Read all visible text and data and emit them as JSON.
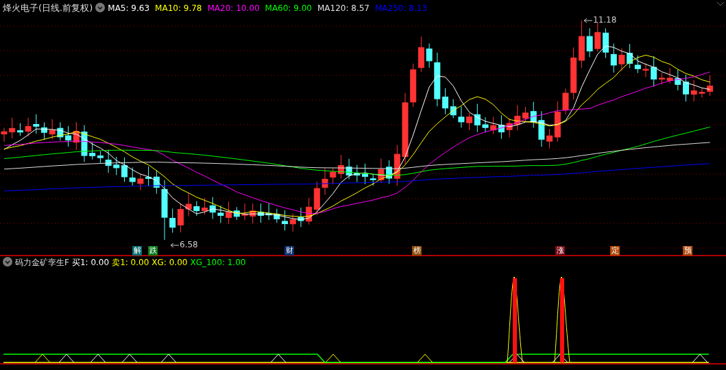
{
  "stock": {
    "name": "烽火电子",
    "period": "(日线.前复权)"
  },
  "ma_readouts": [
    {
      "label": "MA5: 9.63",
      "color": "#ffffff"
    },
    {
      "label": "MA10: 9.78",
      "color": "#ffff00"
    },
    {
      "label": "MA20: 10.00",
      "color": "#ff00ff"
    },
    {
      "label": "MA60: 9.00",
      "color": "#00ff00"
    },
    {
      "label": "MA120: 8.57",
      "color": "#e0e0e0"
    },
    {
      "label": "MA250: 8.13",
      "color": "#0000ff"
    }
  ],
  "price_annotations": {
    "high": "11.18",
    "low": "6.58"
  },
  "event_markers": [
    {
      "label": "解",
      "color": "#0a6e70"
    },
    {
      "label": "跌",
      "color": "#0a7a1e"
    },
    {
      "label": "财",
      "color": "#0c2e6e"
    },
    {
      "label": "榜",
      "color": "#8a4c0a"
    },
    {
      "label": "涨",
      "color": "#7a0a16"
    },
    {
      "label": "定",
      "color": "#b04a0c"
    },
    {
      "label": "预",
      "color": "#b04a0c"
    }
  ],
  "indicator": {
    "name": "码力金矿孪生F",
    "readouts": [
      {
        "label": "买1: 0.00",
        "color": "#ffffff"
      },
      {
        "label": "卖1: 0.00",
        "color": "#ffff00"
      },
      {
        "label": "XG: 0.00",
        "color": "#ffff00"
      },
      {
        "label": "XG_100: 1.00",
        "color": "#00ff00"
      }
    ]
  }
}
